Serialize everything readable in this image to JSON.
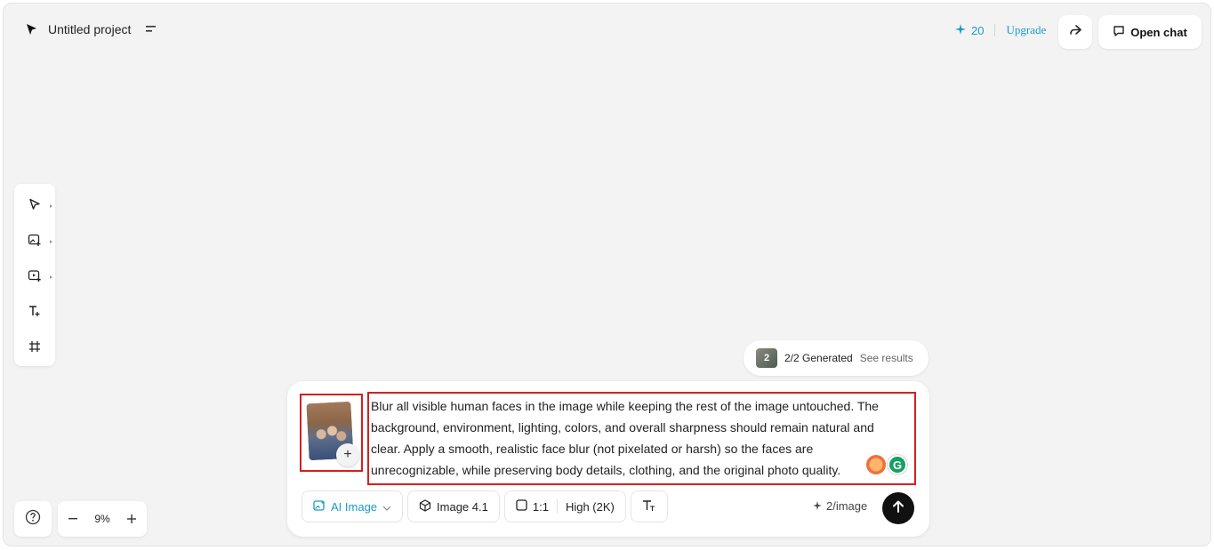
{
  "header": {
    "project_title": "Untitled project",
    "credits": "20",
    "upgrade_label": "Upgrade",
    "open_chat_label": "Open chat"
  },
  "toolbar": {
    "tools": [
      "select-tool",
      "image-generate-tool",
      "video-generate-tool",
      "text-tool",
      "frame-tool"
    ]
  },
  "zoom": {
    "level": "9%"
  },
  "results": {
    "badge": "2",
    "generated": "2/2 Generated",
    "see_results": "See results"
  },
  "prompt": {
    "text": "Blur all visible human faces in the image while keeping the rest of the image untouched. The background, environment, lighting, colors, and overall sharpness should remain natural and clear. Apply a smooth, realistic face blur (not pixelated or harsh) so the faces are unrecognizable, while preserving body details, clothing, and the original photo quality.",
    "add_reference": "+"
  },
  "controls": {
    "mode": "AI Image",
    "model": "Image 4.1",
    "ratio": "1:1",
    "quality": "High (2K)",
    "cost": "2/image"
  },
  "colors": {
    "accent": "#1a9bc4",
    "highlight": "#d61f1f",
    "send_button": "#111111"
  }
}
